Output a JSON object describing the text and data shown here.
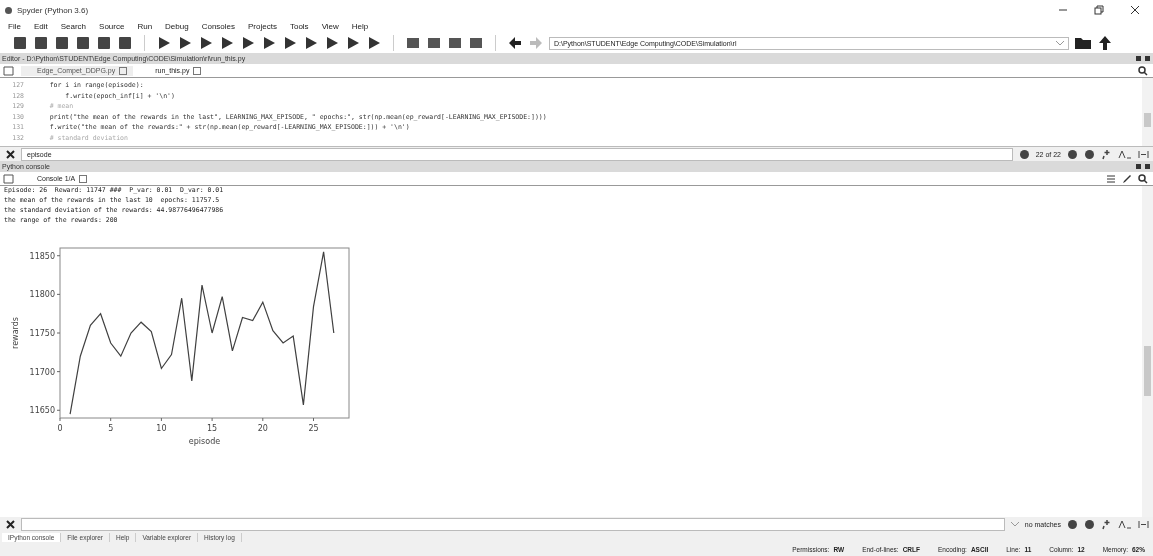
{
  "window": {
    "title": "Spyder (Python 3.6)"
  },
  "menu": [
    "File",
    "Edit",
    "Search",
    "Source",
    "Run",
    "Debug",
    "Consoles",
    "Projects",
    "Tools",
    "View",
    "Help"
  ],
  "path_field": {
    "value": "D:\\Python\\STUDENT\\Edge Computing\\CODE\\Simulation\\rl"
  },
  "editor": {
    "title": "Editor - D:\\Python\\STUDENT\\Edge Computing\\CODE\\Simulation\\rl\\run_this.py",
    "tabs": [
      {
        "label": "Edge_Compet_DDPG.py",
        "selected": false
      },
      {
        "label": "run_this.py",
        "selected": true
      }
    ],
    "lines": [
      {
        "number": "127",
        "code": "    for i in range(episode):",
        "kind": "code"
      },
      {
        "number": "128",
        "code": "        f.write(epoch_inf[i] + '\\n')",
        "kind": "code"
      },
      {
        "number": "129",
        "code": "    # mean",
        "kind": "comment"
      },
      {
        "number": "130",
        "code": "    print(\"the mean of the rewards in the last\", LEARNING_MAX_EPISODE, \" epochs:\", str(np.mean(ep_reward[-LEARNING_MAX_EPISODE:])))",
        "kind": "code"
      },
      {
        "number": "131",
        "code": "    f.write(\"the mean of the rewards:\" + str(np.mean(ep_reward[-LEARNING_MAX_EPISODE:])) + '\\n')",
        "kind": "code"
      },
      {
        "number": "132",
        "code": "    # standard deviation",
        "kind": "comment"
      }
    ]
  },
  "find": {
    "value": "episode",
    "result": "22 of 22"
  },
  "console": {
    "title": "Python console",
    "tab": "Console 1/A",
    "lines": [
      "Episode: 26  Reward: 11747 ###  P_var: 0.01  D_var: 0.01",
      "the mean of the rewards in the last 10  epochs: 11757.5",
      "the standard deviation of the rewards: 44.98776496477986",
      "the range of the rewards: 200"
    ],
    "chart_data": {
      "type": "line",
      "xlabel": "episode",
      "ylabel": "rewards",
      "x": [
        1,
        2,
        3,
        4,
        5,
        6,
        7,
        8,
        9,
        10,
        11,
        12,
        13,
        14,
        15,
        16,
        17,
        18,
        19,
        20,
        21,
        22,
        23,
        24,
        25,
        26,
        27
      ],
      "series": [
        {
          "color": "#404040",
          "values": [
            11645,
            11720,
            11760,
            11775,
            11737,
            11720,
            11750,
            11764,
            11752,
            11704,
            11722,
            11795,
            11688,
            11812,
            11750,
            11797,
            11727,
            11770,
            11766,
            11790,
            11753,
            11737,
            11746,
            11657,
            11784,
            11855,
            11750
          ]
        }
      ],
      "xlim": [
        0,
        28.5
      ],
      "ylim": [
        11640,
        11860
      ],
      "xticks": [
        0,
        5,
        10,
        15,
        20,
        25
      ],
      "yticks": [
        11650,
        11700,
        11750,
        11800,
        11850
      ]
    }
  },
  "bottom_find": {
    "result": "no matches"
  },
  "bottom_tabs": [
    {
      "label": "IPython console",
      "selected": true
    },
    {
      "label": "File explorer",
      "selected": false
    },
    {
      "label": "Help",
      "selected": false
    },
    {
      "label": "Variable explorer",
      "selected": false
    },
    {
      "label": "History log",
      "selected": false
    }
  ],
  "status_bar": [
    {
      "label": "Permissions:",
      "value": "RW"
    },
    {
      "label": "End-of-lines:",
      "value": "CRLF"
    },
    {
      "label": "Encoding:",
      "value": "ASCII"
    },
    {
      "label": "Line:",
      "value": "11"
    },
    {
      "label": "Column:",
      "value": "12"
    },
    {
      "label": "Memory:",
      "value": "62%"
    }
  ]
}
